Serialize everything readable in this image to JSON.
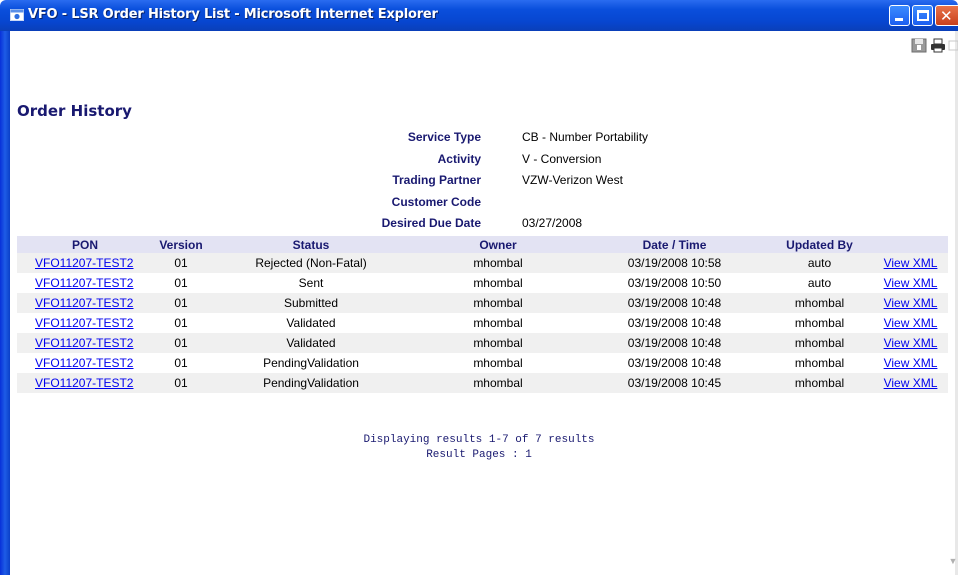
{
  "window": {
    "title": "VFO - LSR Order History List - Microsoft Internet Explorer",
    "close_glyph": "✕"
  },
  "page": {
    "title": "Order History"
  },
  "order_info": [
    {
      "label": "Service Type",
      "value": "CB - Number Portability"
    },
    {
      "label": "Activity",
      "value": "V - Conversion"
    },
    {
      "label": "Trading Partner",
      "value": "VZW-Verizon West"
    },
    {
      "label": "Customer Code",
      "value": ""
    },
    {
      "label": "Desired Due Date",
      "value": "03/27/2008"
    }
  ],
  "table": {
    "headers": [
      "PON",
      "Version",
      "Status",
      "Owner",
      "Date / Time",
      "Updated By",
      ""
    ],
    "rows": [
      {
        "pon": "VFO11207-TEST2",
        "version": "01",
        "status": "Rejected (Non-Fatal)",
        "owner": "mhombal",
        "datetime": "03/19/2008 10:58",
        "updated_by": "auto",
        "action": "View XML"
      },
      {
        "pon": "VFO11207-TEST2",
        "version": "01",
        "status": "Sent",
        "owner": "mhombal",
        "datetime": "03/19/2008 10:50",
        "updated_by": "auto",
        "action": "View XML"
      },
      {
        "pon": "VFO11207-TEST2",
        "version": "01",
        "status": "Submitted",
        "owner": "mhombal",
        "datetime": "03/19/2008 10:48",
        "updated_by": "mhombal",
        "action": "View XML"
      },
      {
        "pon": "VFO11207-TEST2",
        "version": "01",
        "status": "Validated",
        "owner": "mhombal",
        "datetime": "03/19/2008 10:48",
        "updated_by": "mhombal",
        "action": "View XML"
      },
      {
        "pon": "VFO11207-TEST2",
        "version": "01",
        "status": "Validated",
        "owner": "mhombal",
        "datetime": "03/19/2008 10:48",
        "updated_by": "mhombal",
        "action": "View XML"
      },
      {
        "pon": "VFO11207-TEST2",
        "version": "01",
        "status": "PendingValidation",
        "owner": "mhombal",
        "datetime": "03/19/2008 10:48",
        "updated_by": "mhombal",
        "action": "View XML"
      },
      {
        "pon": "VFO11207-TEST2",
        "version": "01",
        "status": "PendingValidation",
        "owner": "mhombal",
        "datetime": "03/19/2008 10:45",
        "updated_by": "mhombal",
        "action": "View XML"
      }
    ]
  },
  "footer": {
    "results_text": "Displaying results 1-7 of 7 results",
    "pages_text": "Result Pages :  1"
  },
  "icons": {
    "app": "ie-window-icon",
    "save": "save-disk-icon",
    "print": "printer-icon"
  },
  "colors": {
    "titlebar": "#0a4fdc",
    "heading_navy": "#191970",
    "link": "#0000ee",
    "header_bg": "#e3e3f3",
    "row_alt": "#f0f0f0"
  }
}
